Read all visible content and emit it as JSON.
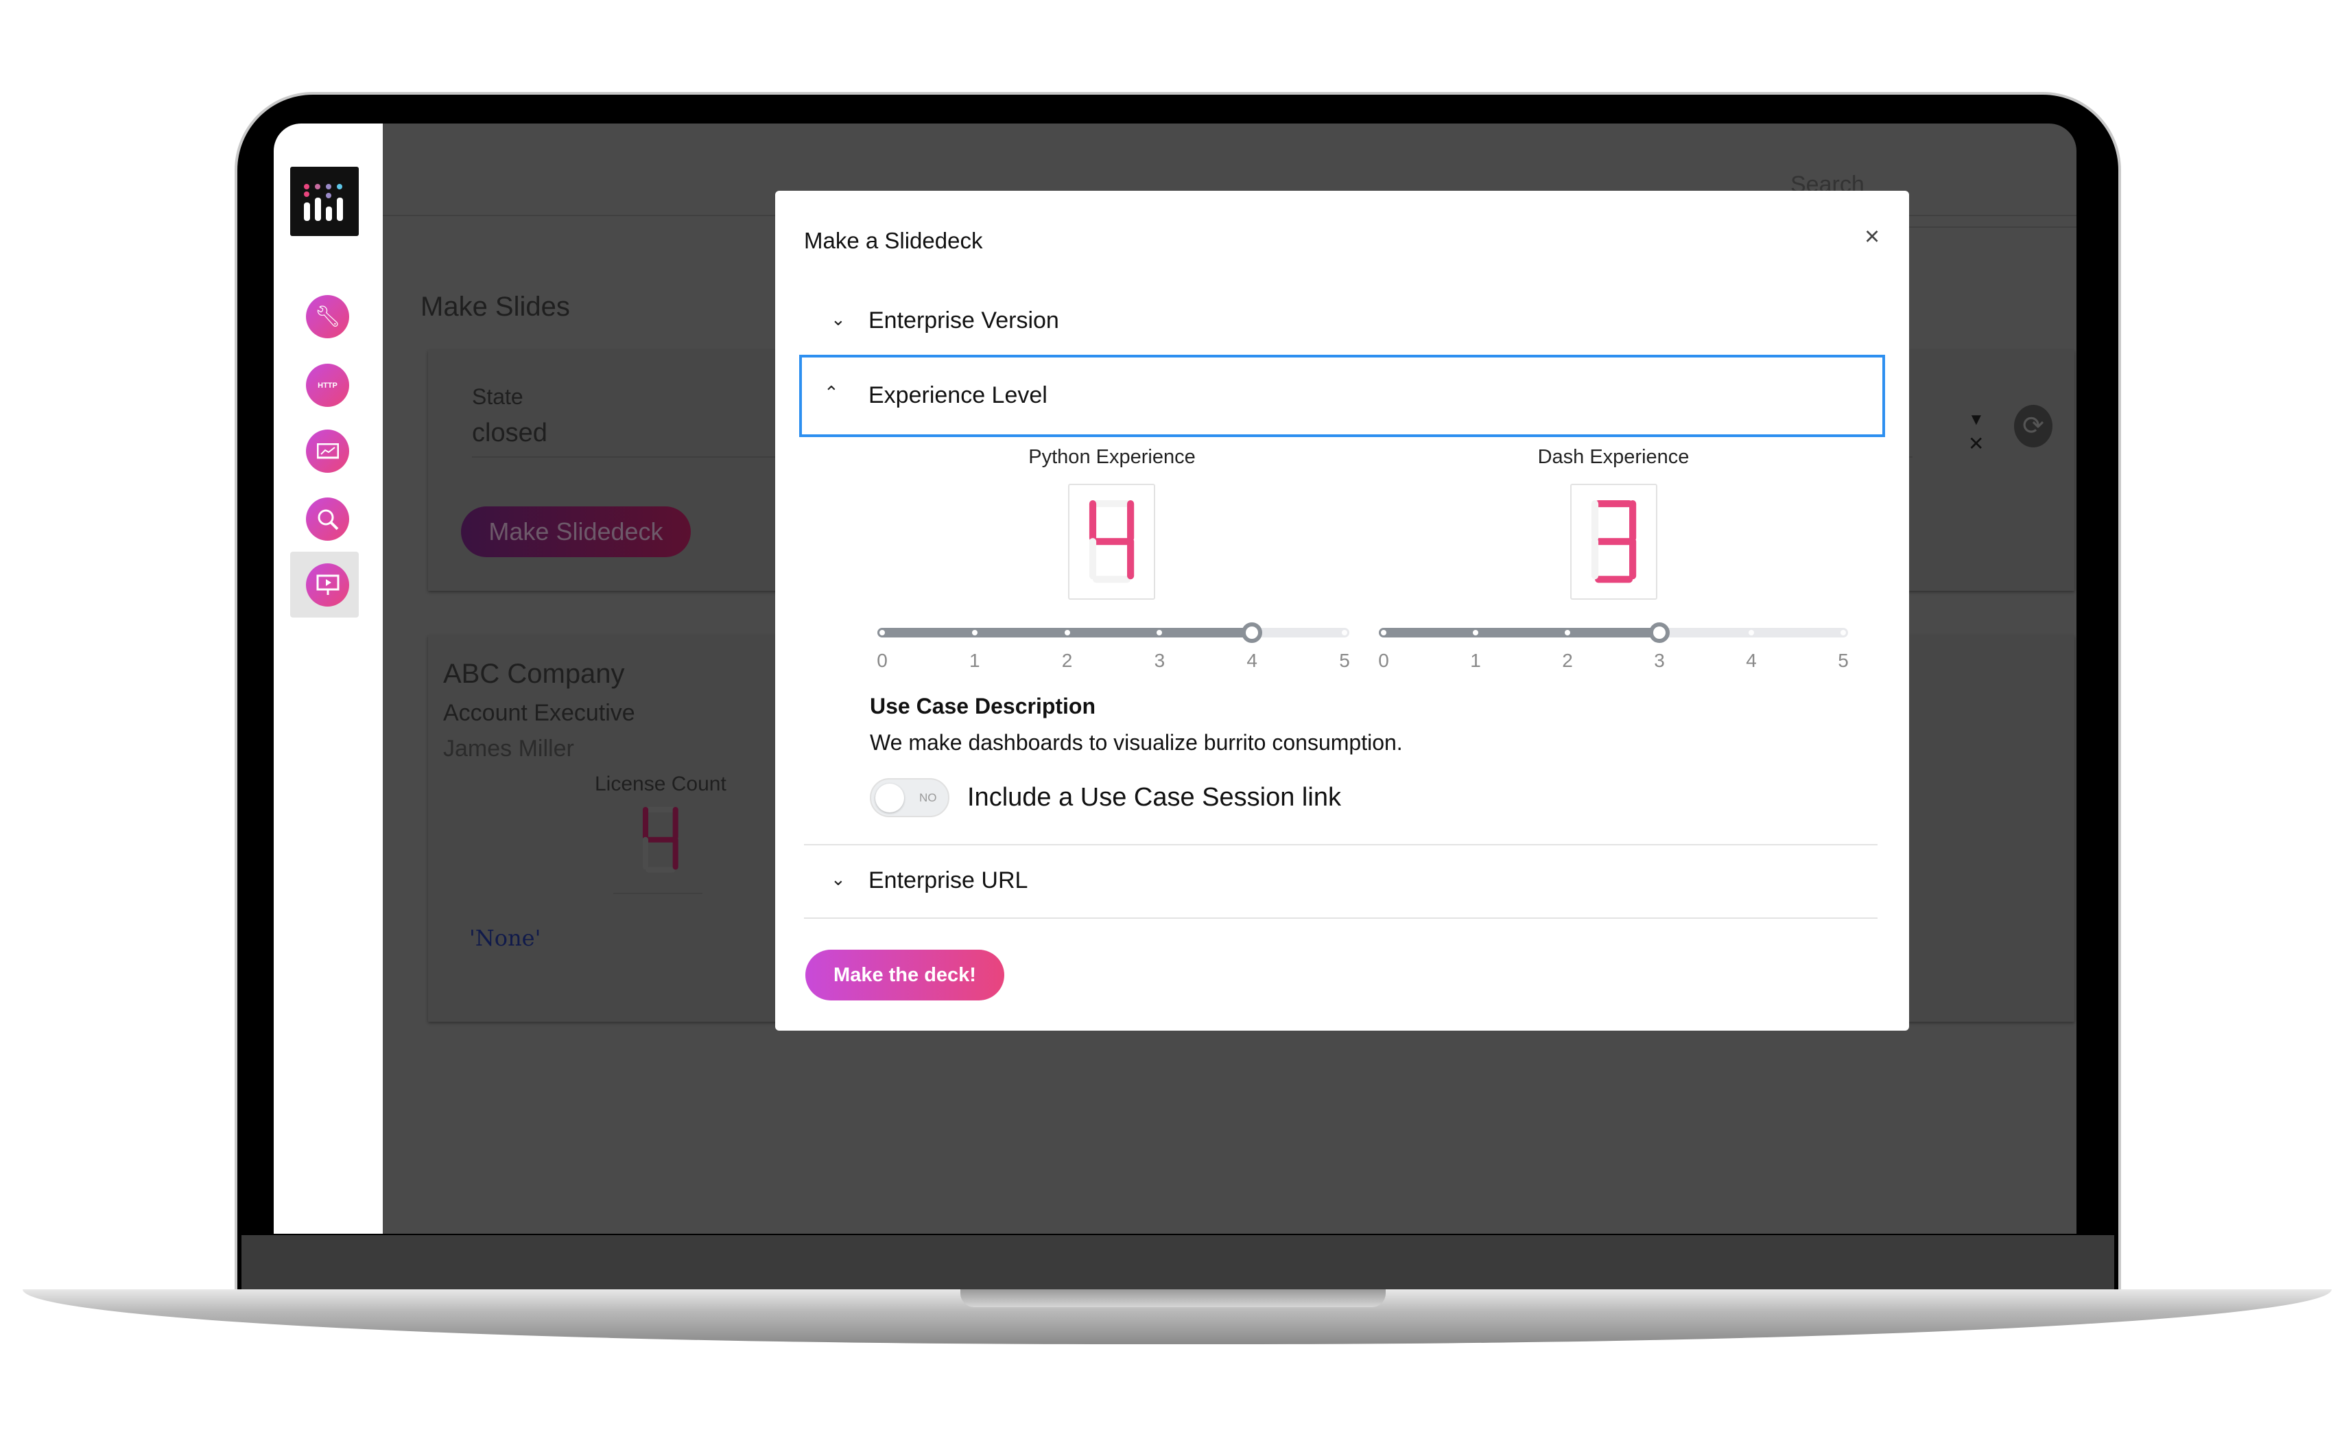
{
  "background": {
    "search_placeholder": "Search",
    "page_title": "Make Slides",
    "state_label": "State",
    "state_value": "closed",
    "make_slidedeck_button": "Make Slidedeck",
    "company": "ABC Company",
    "role": "Account Executive",
    "person": "James Miller",
    "license_count_label": "License Count",
    "license_count": 4,
    "code_output": "'None'"
  },
  "sidebar": {
    "items": [
      {
        "icon": "wrench-icon"
      },
      {
        "icon": "http-icon",
        "label": "HTTP"
      },
      {
        "icon": "chart-icon"
      },
      {
        "icon": "search-icon"
      },
      {
        "icon": "presentation-icon",
        "selected": true
      }
    ]
  },
  "modal": {
    "title": "Make a Slidedeck",
    "close": "×",
    "sections": [
      {
        "label": "Enterprise Version",
        "expanded": false
      },
      {
        "label": "Experience Level",
        "expanded": true
      },
      {
        "label": "Enterprise URL",
        "expanded": false
      }
    ],
    "python": {
      "label": "Python Experience",
      "value": 4,
      "min": 0,
      "max": 5,
      "ticks": [
        "0",
        "1",
        "2",
        "3",
        "4",
        "5"
      ]
    },
    "dash": {
      "label": "Dash Experience",
      "value": 3,
      "min": 0,
      "max": 5,
      "ticks": [
        "0",
        "1",
        "2",
        "3",
        "4",
        "5"
      ]
    },
    "use_case_title": "Use Case Description",
    "use_case_text": "We make dashboards to visualize burrito consumption.",
    "toggle": {
      "state_text": "NO",
      "on": false,
      "label": "Include a Use Case Session link"
    },
    "submit": "Make the deck!"
  },
  "colors": {
    "accent": "#e8457e",
    "accent2": "#c84ad8",
    "focus": "#2d8ff0",
    "led": "#e8457e"
  }
}
